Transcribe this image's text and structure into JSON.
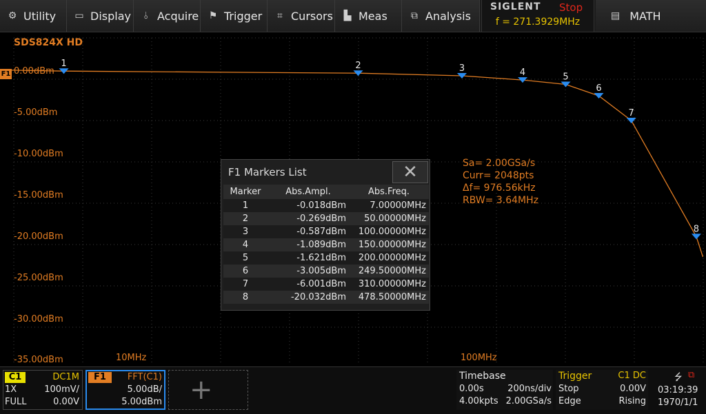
{
  "menu": [
    {
      "label": "Utility",
      "icon": "gear-icon",
      "glyph": "⚙"
    },
    {
      "label": "Display",
      "icon": "monitor-icon",
      "glyph": "▭"
    },
    {
      "label": "Acquire",
      "icon": "acquire-icon",
      "glyph": "⫰"
    },
    {
      "label": "Trigger",
      "icon": "flag-icon",
      "glyph": "⚑"
    },
    {
      "label": "Cursors",
      "icon": "cursor-icon",
      "glyph": "⌗"
    },
    {
      "label": "Meas",
      "icon": "measure-icon",
      "glyph": "▙"
    },
    {
      "label": "Analysis",
      "icon": "analysis-icon",
      "glyph": "⧉"
    }
  ],
  "brand": {
    "name": "SIGLENT",
    "state": "Stop",
    "freq": "f = 271.3929MHz"
  },
  "math": {
    "label": "MATH",
    "icon": "math-icon"
  },
  "screen": {
    "model": "SDS824X HD",
    "trace_tag": "F1",
    "y_labels": [
      "0.00dBm",
      "-5.00dBm",
      "-10.00dBm",
      "-15.00dBm",
      "-20.00dBm",
      "-25.00dBm",
      "-30.00dBm",
      "-35.00dBm"
    ],
    "x_labels": [
      "10MHz",
      "100MHz"
    ],
    "trace_color": "#e27d23",
    "marker_color": "#2a8cf0"
  },
  "markers_list": {
    "title": "F1 Markers List",
    "headers": [
      "Marker",
      "Abs.Ampl.",
      "Abs.Freq."
    ],
    "rows": [
      [
        "1",
        "-0.018dBm",
        "7.00000MHz"
      ],
      [
        "2",
        "-0.269dBm",
        "50.00000MHz"
      ],
      [
        "3",
        "-0.587dBm",
        "100.00000MHz"
      ],
      [
        "4",
        "-1.089dBm",
        "150.00000MHz"
      ],
      [
        "5",
        "-1.621dBm",
        "200.00000MHz"
      ],
      [
        "6",
        "-3.005dBm",
        "249.50000MHz"
      ],
      [
        "7",
        "-6.001dBm",
        "310.00000MHz"
      ],
      [
        "8",
        "-20.032dBm",
        "478.50000MHz"
      ]
    ]
  },
  "fft_params": [
    "Sa=  2.00GSa/s",
    "Curr= 2048pts",
    "Δf=  976.56kHz",
    "RBW=  3.64MHz"
  ],
  "chart_data": {
    "type": "line",
    "x_scale": "log",
    "x": [
      3.5,
      7,
      50,
      100,
      150,
      200,
      249.5,
      310,
      478.5,
      500
    ],
    "series": [
      {
        "values": [
          0.2,
          -0.018,
          -0.269,
          -0.587,
          -1.089,
          -1.621,
          -3.005,
          -6.001,
          -20.032,
          -22.5
        ]
      }
    ],
    "ylim": [
      -35,
      0
    ],
    "grid": true
  },
  "bottom": {
    "c1": {
      "label": "C1",
      "coupling": "DC1M",
      "probe": "1X",
      "scale": "100mV/",
      "bw": "FULL",
      "offset": "0.00V"
    },
    "f1": {
      "label": "F1",
      "source": "FFT(C1)",
      "scale": "5.00dB/",
      "ref": "5.00dBm"
    },
    "timebase": {
      "title": "Timebase",
      "delay": "0.00s",
      "tdiv": "200ns/div",
      "pts": "4.00kpts",
      "sa": "2.00GSa/s"
    },
    "trigger": {
      "title": "Trigger",
      "source": "C1 DC",
      "state": "Stop",
      "level": "0.00V",
      "type": "Edge",
      "slope": "Rising"
    },
    "clock": {
      "time": "03:19:39",
      "date": "1970/1/1"
    }
  }
}
